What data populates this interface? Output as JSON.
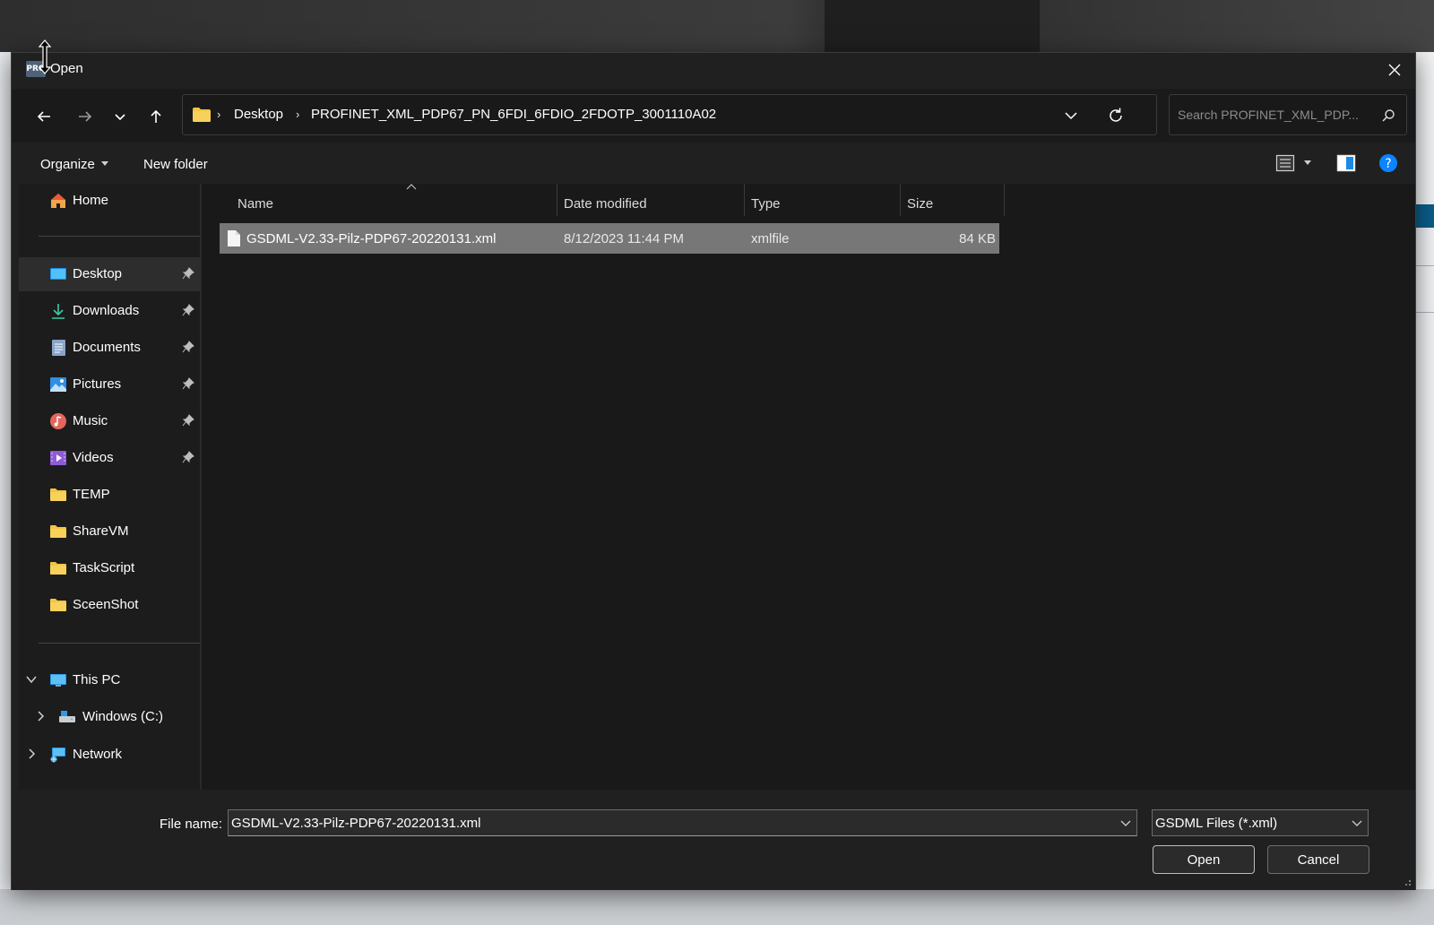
{
  "dialog": {
    "title": "Open",
    "app_icon_text": "PRO"
  },
  "address": {
    "crumbs": [
      "Desktop",
      "PROFINET_XML_PDP67_PN_6FDI_6FDIO_2FDOTP_3001110A02"
    ]
  },
  "search": {
    "placeholder": "Search PROFINET_XML_PDP..."
  },
  "toolbar": {
    "organize_label": "Organize",
    "new_folder_label": "New folder"
  },
  "sidebar": {
    "home_label": "Home",
    "quick_access": [
      {
        "label": "Desktop",
        "icon": "desktop-icon",
        "pinned": true
      },
      {
        "label": "Downloads",
        "icon": "download-icon",
        "pinned": true
      },
      {
        "label": "Documents",
        "icon": "documents-icon",
        "pinned": true
      },
      {
        "label": "Pictures",
        "icon": "pictures-icon",
        "pinned": true
      },
      {
        "label": "Music",
        "icon": "music-icon",
        "pinned": true
      },
      {
        "label": "Videos",
        "icon": "videos-icon",
        "pinned": true
      },
      {
        "label": "TEMP",
        "icon": "folder-icon",
        "pinned": false
      },
      {
        "label": "ShareVM",
        "icon": "folder-icon",
        "pinned": false
      },
      {
        "label": "TaskScript",
        "icon": "folder-icon",
        "pinned": false
      },
      {
        "label": "SceenShot",
        "icon": "folder-icon",
        "pinned": false
      }
    ],
    "this_pc_label": "This PC",
    "windows_drive_label": "Windows (C:)",
    "network_label": "Network"
  },
  "columns": {
    "name": "Name",
    "date": "Date modified",
    "type": "Type",
    "size": "Size"
  },
  "files": [
    {
      "name": "GSDML-V2.33-Pilz-PDP67-20220131.xml",
      "date": "8/12/2023 11:44 PM",
      "type": "xmlfile",
      "size": "84 KB",
      "selected": true
    }
  ],
  "bottom": {
    "file_name_label": "File name:",
    "file_name_value": "GSDML-V2.33-Pilz-PDP67-20220131.xml",
    "file_type_value": "GSDML Files (*.xml)",
    "open_label": "Open",
    "cancel_label": "Cancel"
  },
  "colors": {
    "dialog_bg": "#202020",
    "selection": "#777777",
    "folder": "#f4c542",
    "accent": "#0a84ff"
  }
}
